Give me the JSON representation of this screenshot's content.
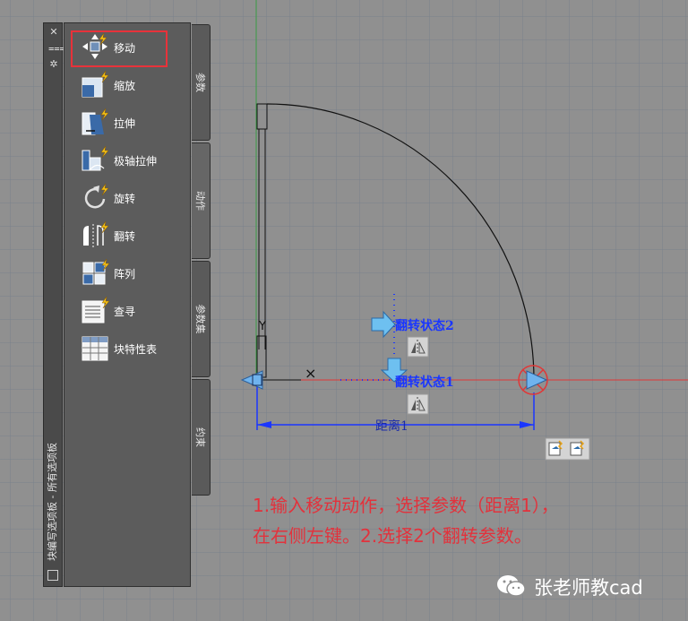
{
  "palette": {
    "title": "块编写选项板 - 所有选项板",
    "controls": {
      "close": "✕",
      "autohide": "⩶",
      "properties": "✲"
    },
    "items": [
      {
        "label": "移动",
        "icon": "move-icon"
      },
      {
        "label": "缩放",
        "icon": "scale-icon"
      },
      {
        "label": "拉伸",
        "icon": "stretch-icon"
      },
      {
        "label": "极轴拉伸",
        "icon": "polar-stretch-icon"
      },
      {
        "label": "旋转",
        "icon": "rotate-icon"
      },
      {
        "label": "翻转",
        "icon": "flip-icon"
      },
      {
        "label": "阵列",
        "icon": "array-icon"
      },
      {
        "label": "查寻",
        "icon": "lookup-icon"
      },
      {
        "label": "块特性表",
        "icon": "block-properties-table-icon"
      }
    ],
    "tabs": [
      {
        "label": "参数",
        "active": false
      },
      {
        "label": "动作",
        "active": true
      },
      {
        "label": "参数集",
        "active": false
      },
      {
        "label": "约束",
        "active": false
      }
    ]
  },
  "drawing": {
    "flip_state_2": "翻转状态2",
    "flip_state_1": "翻转状态1",
    "distance_param": "距离1",
    "colors": {
      "parameter": "#1a36ff",
      "grip": "#5aa0e6",
      "x_axis": "#e03838",
      "y_axis": "#2f8f3a"
    }
  },
  "instructions": {
    "line1": "1.输入移动动作，选择参数（距离1），",
    "line2": "在右侧左键。2.选择2个翻转参数。"
  },
  "watermark": {
    "text": "张老师教cad",
    "icon": "wechat-icon"
  }
}
